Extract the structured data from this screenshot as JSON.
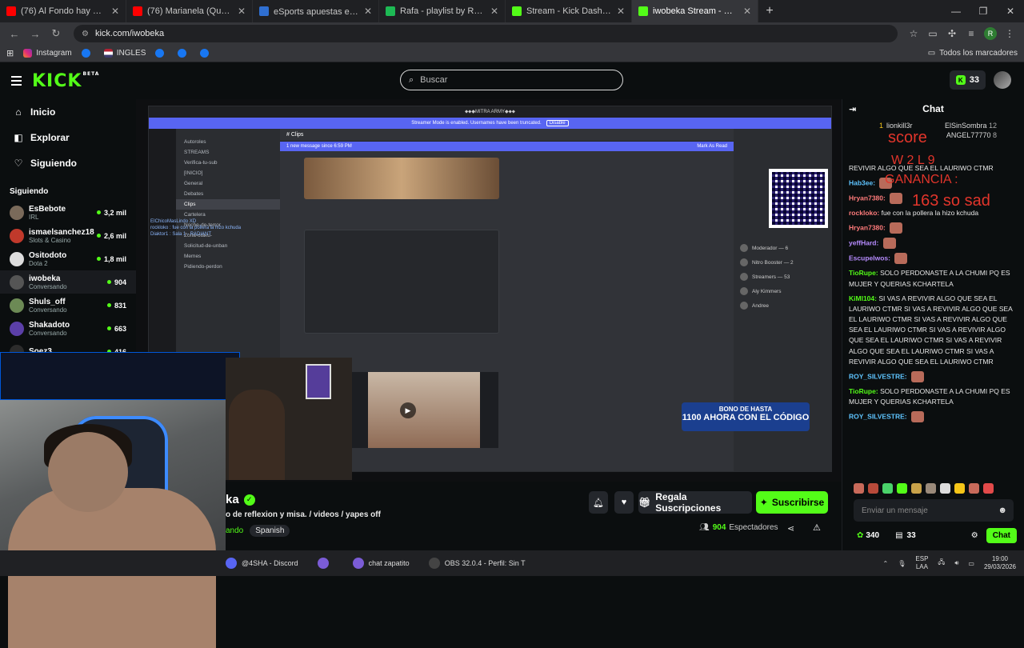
{
  "browser": {
    "tabs": [
      {
        "title": "(76) Al Fondo hay Sitio 8: Ferna",
        "color": "#ff0000"
      },
      {
        "title": "(76) Marianela (Que Pasa) (Exte",
        "color": "#ff0000"
      },
      {
        "title": "eSports apuestas en directo ▶",
        "color": "#2f6fd1"
      },
      {
        "title": "Rafa - playlist by RafaelJxared |",
        "color": "#1db954"
      },
      {
        "title": "Stream - Kick Dashboard",
        "color": "#53fc18"
      },
      {
        "title": "iwobeka Stream - Watch Li",
        "color": "#53fc18",
        "active": true
      }
    ],
    "url": "kick.com/iwobeka",
    "profile_initial": "R",
    "bookmarks": [
      "Instagram",
      "INGLES"
    ],
    "bookmarks_all": "Todos los marcadores"
  },
  "kick": {
    "logo": "KICK",
    "logo_beta": "BETA",
    "search_placeholder": "Buscar",
    "kicks": "33"
  },
  "sidebar": {
    "nav": [
      {
        "label": "Inicio",
        "icon": "home-icon"
      },
      {
        "label": "Explorar",
        "icon": "compass-icon"
      },
      {
        "label": "Siguiendo",
        "icon": "heart-icon"
      }
    ],
    "section": "Siguiendo",
    "channels": [
      {
        "name": "EsBebote",
        "cat": "IRL",
        "viewers": "3,2 mil",
        "color": "#7a6a5a"
      },
      {
        "name": "ismaelsanchez18",
        "cat": "Slots & Casino",
        "viewers": "2,6 mil",
        "color": "#c0392b"
      },
      {
        "name": "Ositodoto",
        "cat": "Dota 2",
        "viewers": "1,8 mil",
        "color": "#dddddd"
      },
      {
        "name": "iwobeka",
        "cat": "Conversando",
        "viewers": "904",
        "color": "#555555",
        "active": true
      },
      {
        "name": "Shuls_off",
        "cat": "Conversando",
        "viewers": "831",
        "color": "#6c8a55"
      },
      {
        "name": "Shakadoto",
        "cat": "Conversando",
        "viewers": "663",
        "color": "#5b3fa8"
      },
      {
        "name": "Soez3",
        "cat": "",
        "viewers": "416",
        "color": "#2c2c2c"
      }
    ]
  },
  "stream": {
    "discord_title": "⬥⬥◆MITRA ARMY◆⬥⬥",
    "streamer_mode": "Streamer Mode is enabled. Usernames have been truncated.",
    "disable": "Disable",
    "channel_header": "Clips",
    "new_message": "1 new message since 6:59 PM",
    "mark_read": "Mark As Read",
    "channels": [
      "Autoroles",
      "STREAMS",
      "Verifica-tu-sub",
      "[INICIO]",
      "General",
      "Debates",
      "Clips",
      "Cartelera",
      "Noche-de-terror",
      "Zona-otaku-",
      "Solicitud-de-unban",
      "Memes",
      "Pidiendo-perdon"
    ],
    "chatlines": [
      "EIChicoMasLindo XD",
      "rockloko : fue con la pollera la hizo kchuda",
      "Diaktor1 : Sala 1 - RADIANT"
    ],
    "members": [
      "Moderador — 6",
      "Nitro Booster — 2",
      "Streamers — 53",
      "Aly Kimmers",
      "Andree"
    ],
    "promo_line1": "BONO DE HASTA",
    "promo_line2": "1100 AHORA CON EL CÓDIGO"
  },
  "info": {
    "name": "ka",
    "title": "o de reflexion y misa.  /  videos / yapes off",
    "category": "ando",
    "tag": "Spanish",
    "gift": "Regala Suscripciones",
    "subscribe": "Suscribirse",
    "viewers": "904",
    "viewers_label": "Espectadores"
  },
  "chat": {
    "title": "Chat",
    "pinned_left": "lionkill3r",
    "pinned_left_n": "1",
    "pinned_right": "ElSinSombra",
    "pinned_right_n": "12",
    "pinned_right2": "ANGEL77770",
    "pinned_right2_n": "8",
    "overlay_score": "score",
    "overlay_w": "W 2  L 9",
    "overlay_ganancia": "GANANCIA :",
    "overlay_value": "163  so sad",
    "messages": [
      {
        "user": "",
        "text": "REVIVIR ALGO QUE SEA EL LAURIWO CTMR",
        "color": "#e8e8e8"
      },
      {
        "user": "Hab3ee:",
        "text": "",
        "color": "#5ec4ff"
      },
      {
        "user": "Hryan7380:",
        "text": "",
        "color": "#ff7b7b"
      },
      {
        "user": "rockloko:",
        "text": "fue con la pollera la hizo kchuda",
        "color": "#ff7b7b"
      },
      {
        "user": "Hryan7380:",
        "text": "",
        "color": "#ff7b7b"
      },
      {
        "user": "yeffHard:",
        "text": "",
        "color": "#b78cff"
      },
      {
        "user": "Escupelwos:",
        "text": "",
        "color": "#b78cff"
      },
      {
        "user": "TioRupe:",
        "text": "SOLO PERDONASTE A LA CHUMI PQ ES MUJER Y QUERIAS KCHARTELA",
        "color": "#53fc18"
      },
      {
        "user": "KiMI104:",
        "text": "SI VAS A REVIVIR ALGO QUE SEA EL LAURIWO CTMR SI VAS A REVIVIR ALGO QUE SEA EL LAURIWO CTMR SI VAS A REVIVIR ALGO QUE SEA EL LAURIWO CTMR SI VAS A REVIVIR ALGO QUE SEA EL LAURIWO CTMR SI VAS A REVIVIR ALGO QUE SEA EL LAURIWO CTMR SI VAS A REVIVIR ALGO QUE SEA EL LAURIWO CTMR",
        "color": "#53fc18"
      },
      {
        "user": "ROY_SILVESTRE:",
        "text": "",
        "color": "#5ec4ff"
      },
      {
        "user": "TioRupe:",
        "text": "SOLO PERDONASTE A LA CHUMI PQ ES MUJER Y QUERIAS KCHARTELA",
        "color": "#53fc18"
      },
      {
        "user": "ROY_SILVESTRE:",
        "text": "",
        "color": "#5ec4ff"
      }
    ],
    "input_placeholder": "Enviar un mensaje",
    "points": "340",
    "badge_count": "33",
    "chat_button": "Chat"
  },
  "taskbar": {
    "apps": [
      {
        "label": "@4SHA - Discord",
        "color": "#5865f2"
      },
      {
        "label": "",
        "color": "#7b5cd6"
      },
      {
        "label": "chat zapatito",
        "color": "#7b5cd6"
      },
      {
        "label": "OBS 32.0.4 - Perfil: Sin T",
        "color": "#444"
      }
    ],
    "lang": "ESP",
    "lang2": "LAA",
    "time": "19:00",
    "date": "29/03/2026"
  }
}
